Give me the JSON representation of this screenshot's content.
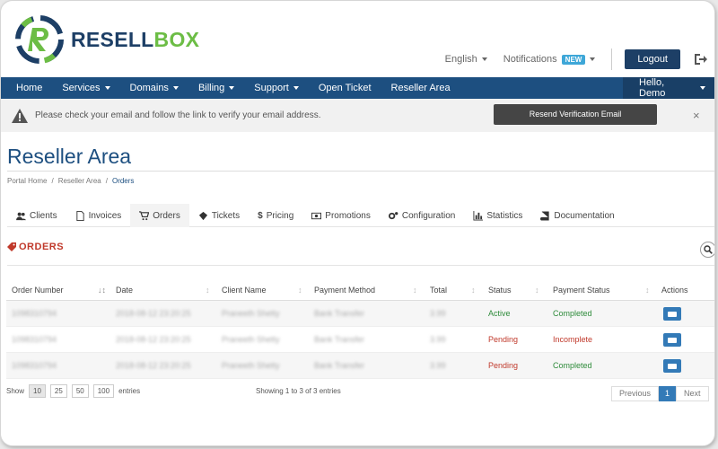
{
  "brand": {
    "part1": "RESELL",
    "part2": "BOX"
  },
  "topbar": {
    "language": "English",
    "notifications": "Notifications",
    "new_badge": "NEW",
    "logout": "Logout"
  },
  "nav": {
    "items": [
      "Home",
      "Services",
      "Domains",
      "Billing",
      "Support",
      "Open Ticket",
      "Reseller Area"
    ],
    "user": "Hello, Demo"
  },
  "alert": {
    "message": "Please check your email and follow the link to verify your email address.",
    "button": "Resend Verification Email",
    "close": "×"
  },
  "page": {
    "title": "Reseller Area",
    "breadcrumb": [
      "Portal Home",
      "Reseller Area",
      "Orders"
    ]
  },
  "tabs": [
    "Clients",
    "Invoices",
    "Orders",
    "Tickets",
    "Pricing",
    "Promotions",
    "Configuration",
    "Statistics",
    "Documentation"
  ],
  "section": {
    "title": "ORDERS"
  },
  "table": {
    "headers": [
      "Order Number",
      "Date",
      "Client Name",
      "Payment Method",
      "Total",
      "Status",
      "Payment Status",
      "Actions"
    ],
    "rows": [
      {
        "order": "1098310794",
        "date": "2018-08-12 23:20:25",
        "client": "Praneeth Shetty",
        "method": "Bank Transfer",
        "total": "3.99",
        "status": "Active",
        "payment": "Completed"
      },
      {
        "order": "1098310794",
        "date": "2018-08-12 23:20:25",
        "client": "Praneeth Shetty",
        "method": "Bank Transfer",
        "total": "3.99",
        "status": "Pending",
        "payment": "Incomplete"
      },
      {
        "order": "1098310794",
        "date": "2018-08-12 23:20:25",
        "client": "Praneeth Shetty",
        "method": "Bank Transfer",
        "total": "3.99",
        "status": "Pending",
        "payment": "Completed"
      }
    ]
  },
  "footer": {
    "show": "Show",
    "sizes": [
      "10",
      "25",
      "50",
      "100"
    ],
    "entries": "entries",
    "showing": "Showing 1 to 3 of 3 entries",
    "previous": "Previous",
    "page": "1",
    "next": "Next"
  },
  "colors": {
    "navy": "#1d4f80",
    "green": "#6cbd45",
    "red": "#c0392b",
    "blue": "#337ab7"
  }
}
